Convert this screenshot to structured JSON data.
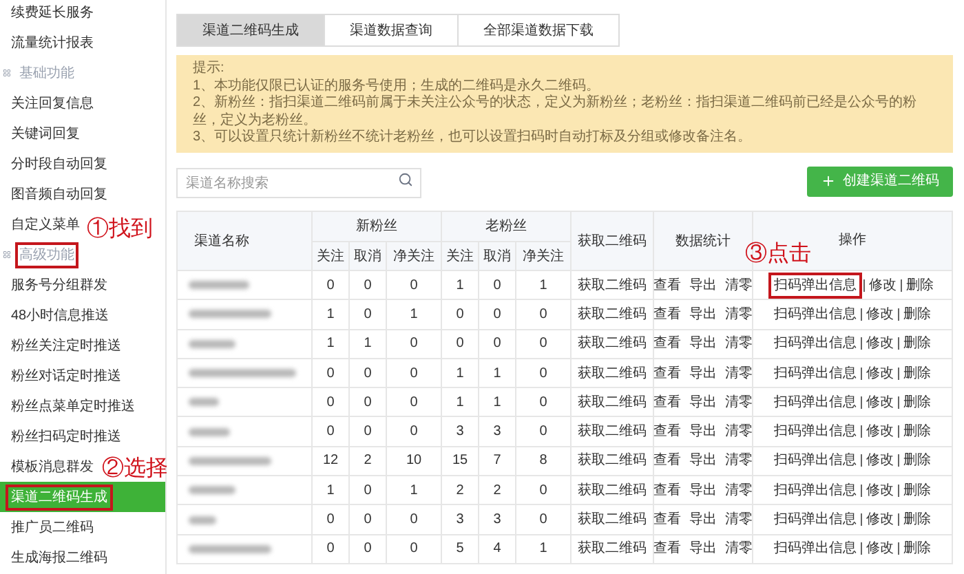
{
  "sidebar": {
    "items": [
      {
        "kind": "item",
        "label": "续费延长服务",
        "selected": false,
        "annotated": false
      },
      {
        "kind": "item",
        "label": "流量统计报表",
        "selected": false,
        "annotated": false
      },
      {
        "kind": "section",
        "label": "基础功能",
        "selected": false,
        "annotated": false
      },
      {
        "kind": "item",
        "label": "关注回复信息",
        "selected": false,
        "annotated": false
      },
      {
        "kind": "item",
        "label": "关键词回复",
        "selected": false,
        "annotated": false
      },
      {
        "kind": "item",
        "label": "分时段自动回复",
        "selected": false,
        "annotated": false
      },
      {
        "kind": "item",
        "label": "图音频自动回复",
        "selected": false,
        "annotated": false
      },
      {
        "kind": "item",
        "label": "自定义菜单",
        "selected": false,
        "annotated": false
      },
      {
        "kind": "section",
        "label": "高级功能",
        "selected": false,
        "annotated": true
      },
      {
        "kind": "item",
        "label": "服务号分组群发",
        "selected": false,
        "annotated": false
      },
      {
        "kind": "item",
        "label": "48小时信息推送",
        "selected": false,
        "annotated": false
      },
      {
        "kind": "item",
        "label": "粉丝关注定时推送",
        "selected": false,
        "annotated": false
      },
      {
        "kind": "item",
        "label": "粉丝对话定时推送",
        "selected": false,
        "annotated": false
      },
      {
        "kind": "item",
        "label": "粉丝点菜单定时推送",
        "selected": false,
        "annotated": false
      },
      {
        "kind": "item",
        "label": "粉丝扫码定时推送",
        "selected": false,
        "annotated": false
      },
      {
        "kind": "item",
        "label": "模板消息群发",
        "selected": false,
        "annotated": false
      },
      {
        "kind": "item",
        "label": "渠道二维码生成",
        "selected": true,
        "annotated": true
      },
      {
        "kind": "item",
        "label": "推广员二维码",
        "selected": false,
        "annotated": false
      },
      {
        "kind": "item",
        "label": "生成海报二维码",
        "selected": false,
        "annotated": false
      }
    ]
  },
  "annotations": [
    "①找到",
    "②选择",
    "③点击"
  ],
  "tabs": [
    {
      "label": "渠道二维码生成",
      "selected": true
    },
    {
      "label": "渠道数据查询",
      "selected": false
    },
    {
      "label": "全部渠道数据下载",
      "selected": false
    }
  ],
  "notice": {
    "title": "提示:",
    "lines": [
      "1、本功能仅限已认证的服务号使用；生成的二维码是永久二维码。",
      "2、新粉丝：指扫渠道二维码前属于未关注公众号的状态，定义为新粉丝；老粉丝：指扫渠道二维码前已经是公众号的粉丝，定义为老粉丝。",
      "3、可以设置只统计新粉丝不统计老粉丝，也可以设置扫码时自动打标及分组或修改备注名。"
    ]
  },
  "search": {
    "placeholder": "渠道名称搜索"
  },
  "create_button": {
    "label": "创建渠道二维码"
  },
  "table": {
    "columns": {
      "name": "渠道名称",
      "new_fans": "新粉丝",
      "old_fans": "老粉丝",
      "get_qr": "获取二维码",
      "stats": "数据统计",
      "actions": "操作",
      "sub": [
        "关注",
        "取消",
        "净关注"
      ],
      "sub_old": [
        "关注",
        "取消",
        "净关注"
      ]
    },
    "rows": [
      {
        "new": [
          "0",
          "0",
          "0"
        ],
        "old": [
          "1",
          "0",
          "1"
        ],
        "qr": "获取二维码",
        "stats": [
          "查看",
          "导出",
          "清零"
        ],
        "ops": [
          {
            "label": "扫码弹出信息",
            "annotated": true
          },
          {
            "label": "修改",
            "annotated": false
          },
          {
            "label": "删除",
            "annotated": false
          }
        ]
      },
      {
        "new": [
          "1",
          "0",
          "1"
        ],
        "old": [
          "0",
          "0",
          "0"
        ],
        "qr": "获取二维码",
        "stats": [
          "查看",
          "导出",
          "清零"
        ],
        "ops": [
          {
            "label": "扫码弹出信息",
            "annotated": false
          },
          {
            "label": "修改",
            "annotated": false
          },
          {
            "label": "删除",
            "annotated": false
          }
        ]
      },
      {
        "new": [
          "1",
          "1",
          "0"
        ],
        "old": [
          "0",
          "0",
          "0"
        ],
        "qr": "获取二维码",
        "stats": [
          "查看",
          "导出",
          "清零"
        ],
        "ops": [
          {
            "label": "扫码弹出信息",
            "annotated": false
          },
          {
            "label": "修改",
            "annotated": false
          },
          {
            "label": "删除",
            "annotated": false
          }
        ]
      },
      {
        "new": [
          "0",
          "0",
          "0"
        ],
        "old": [
          "1",
          "1",
          "0"
        ],
        "qr": "获取二维码",
        "stats": [
          "查看",
          "导出",
          "清零"
        ],
        "ops": [
          {
            "label": "扫码弹出信息",
            "annotated": false
          },
          {
            "label": "修改",
            "annotated": false
          },
          {
            "label": "删除",
            "annotated": false
          }
        ]
      },
      {
        "new": [
          "0",
          "0",
          "0"
        ],
        "old": [
          "1",
          "1",
          "0"
        ],
        "qr": "获取二维码",
        "stats": [
          "查看",
          "导出",
          "清零"
        ],
        "ops": [
          {
            "label": "扫码弹出信息",
            "annotated": false
          },
          {
            "label": "修改",
            "annotated": false
          },
          {
            "label": "删除",
            "annotated": false
          }
        ]
      },
      {
        "new": [
          "0",
          "0",
          "0"
        ],
        "old": [
          "3",
          "3",
          "0"
        ],
        "qr": "获取二维码",
        "stats": [
          "查看",
          "导出",
          "清零"
        ],
        "ops": [
          {
            "label": "扫码弹出信息",
            "annotated": false
          },
          {
            "label": "修改",
            "annotated": false
          },
          {
            "label": "删除",
            "annotated": false
          }
        ]
      },
      {
        "new": [
          "12",
          "2",
          "10"
        ],
        "old": [
          "15",
          "7",
          "8"
        ],
        "qr": "获取二维码",
        "stats": [
          "查看",
          "导出",
          "清零"
        ],
        "ops": [
          {
            "label": "扫码弹出信息",
            "annotated": false
          },
          {
            "label": "修改",
            "annotated": false
          },
          {
            "label": "删除",
            "annotated": false
          }
        ]
      },
      {
        "new": [
          "1",
          "0",
          "1"
        ],
        "old": [
          "2",
          "2",
          "0"
        ],
        "qr": "获取二维码",
        "stats": [
          "查看",
          "导出",
          "清零"
        ],
        "ops": [
          {
            "label": "扫码弹出信息",
            "annotated": false
          },
          {
            "label": "修改",
            "annotated": false
          },
          {
            "label": "删除",
            "annotated": false
          }
        ]
      },
      {
        "new": [
          "0",
          "0",
          "0"
        ],
        "old": [
          "3",
          "3",
          "0"
        ],
        "qr": "获取二维码",
        "stats": [
          "查看",
          "导出",
          "清零"
        ],
        "ops": [
          {
            "label": "扫码弹出信息",
            "annotated": false
          },
          {
            "label": "修改",
            "annotated": false
          },
          {
            "label": "删除",
            "annotated": false
          }
        ]
      },
      {
        "new": [
          "0",
          "0",
          "0"
        ],
        "old": [
          "5",
          "4",
          "1"
        ],
        "qr": "获取二维码",
        "stats": [
          "查看",
          "导出",
          "清零"
        ],
        "ops": [
          {
            "label": "扫码弹出信息",
            "annotated": false
          },
          {
            "label": "修改",
            "annotated": false
          },
          {
            "label": "删除",
            "annotated": false
          }
        ]
      }
    ]
  }
}
